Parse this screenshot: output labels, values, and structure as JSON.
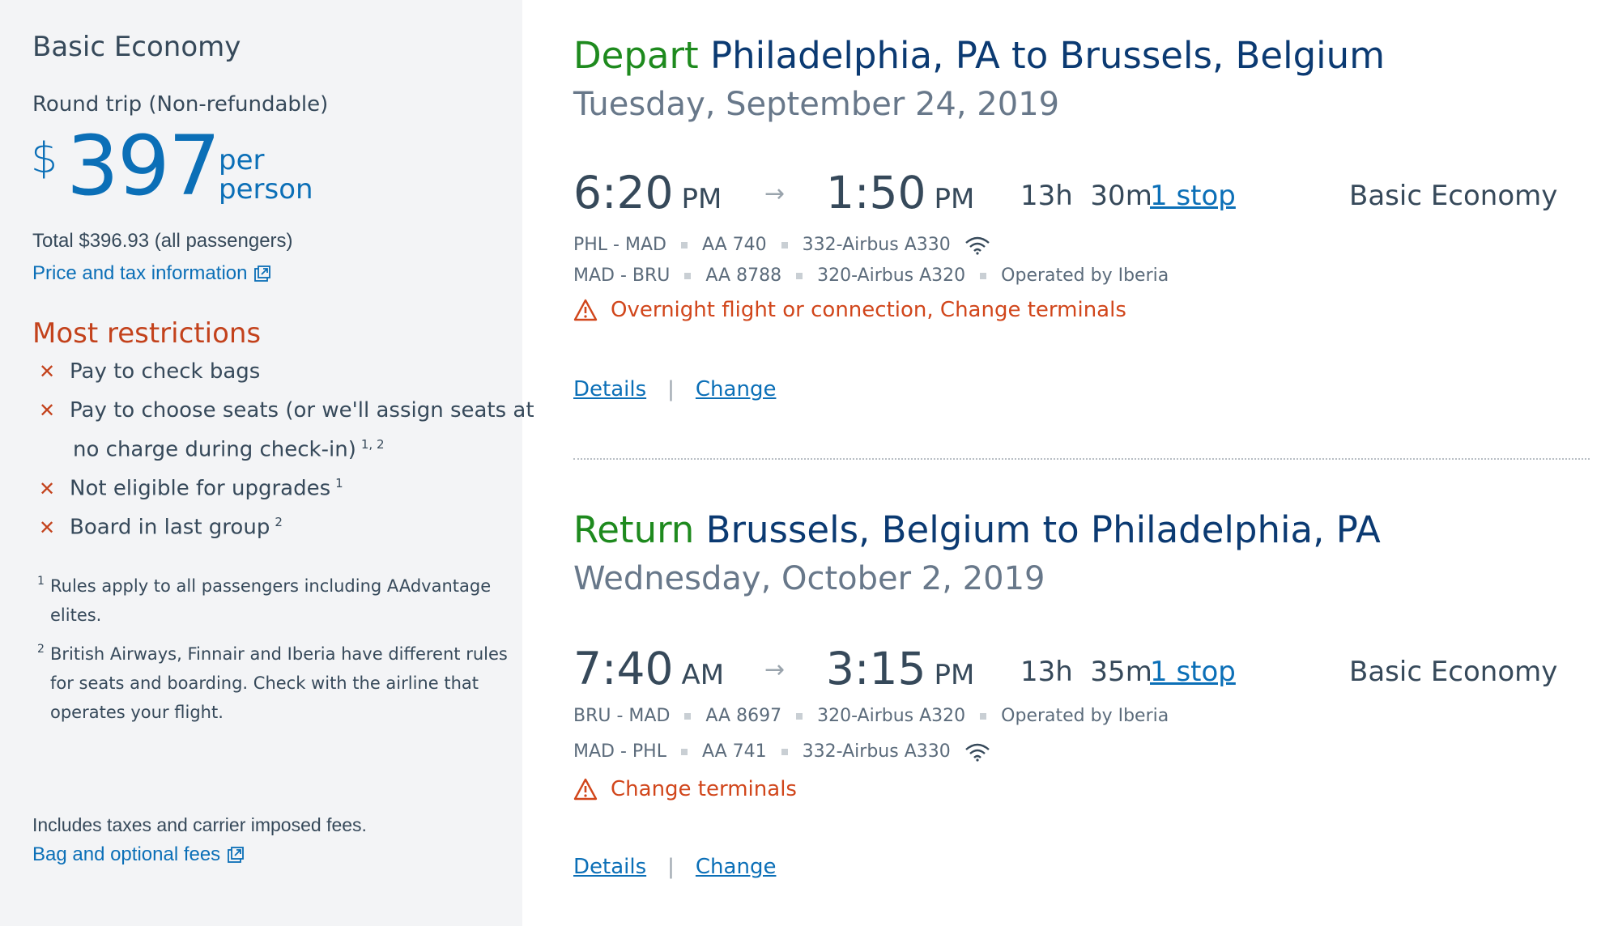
{
  "fare": {
    "title": "Basic Economy",
    "trip_type": "Round trip (Non-refundable)",
    "currency_symbol": "$",
    "price": "397",
    "per_line1": "per",
    "per_line2": "person",
    "total": "Total $396.93 (all passengers)",
    "price_tax_link": "Price and tax information"
  },
  "restrictions": {
    "title": "Most restrictions",
    "items": [
      {
        "text": "Pay to check bags",
        "sup": ""
      },
      {
        "text": "Pay to choose seats (or we'll assign seats at",
        "sup": ""
      },
      {
        "text": "Not eligible for upgrades",
        "sup": "1"
      },
      {
        "text": "Board in last group",
        "sup": "2"
      }
    ],
    "continuation": "no charge during check-in)",
    "continuation_sup": "1, 2",
    "footnotes": [
      {
        "num": "1",
        "text": "Rules apply to all passengers including AAdvantage elites."
      },
      {
        "num": "2",
        "text": "British Airways, Finnair and Iberia have different rules for seats and boarding. Check with the airline that operates your flight."
      }
    ]
  },
  "fees": {
    "includes": "Includes taxes and carrier imposed fees.",
    "bag_link": "Bag and optional fees"
  },
  "depart": {
    "label": "Depart",
    "route": "Philadelphia, PA to Brussels, Belgium",
    "date": "Tuesday, September 24, 2019",
    "dep_time": "6:20",
    "dep_ampm": "PM",
    "arr_time": "1:50",
    "arr_ampm": "PM",
    "duration": "13h  30m",
    "stops": "1 stop",
    "cabin": "Basic Economy",
    "segments": [
      {
        "route": "PHL - MAD",
        "flight": "AA 740",
        "aircraft": "332-Airbus A330",
        "operated": ""
      },
      {
        "route": "MAD - BRU",
        "flight": "AA 8788",
        "aircraft": "320-Airbus A320",
        "operated": "Operated by Iberia"
      }
    ],
    "warning": "Overnight flight or connection, Change terminals",
    "details": "Details",
    "change": "Change"
  },
  "return": {
    "label": "Return",
    "route": "Brussels, Belgium to Philadelphia, PA",
    "date": "Wednesday, October 2, 2019",
    "dep_time": "7:40",
    "dep_ampm": "AM",
    "arr_time": "3:15",
    "arr_ampm": "PM",
    "duration": "13h  35m",
    "stops": "1 stop",
    "cabin": "Basic Economy",
    "segments": [
      {
        "route": "BRU - MAD",
        "flight": "AA 8697",
        "aircraft": "320-Airbus A320",
        "operated": "Operated by Iberia"
      },
      {
        "route": "MAD - PHL",
        "flight": "AA 741",
        "aircraft": "332-Airbus A330",
        "operated": ""
      }
    ],
    "warning": "Change terminals",
    "details": "Details",
    "change": "Change"
  },
  "colors": {
    "accent_blue": "#0b6fb7",
    "route_navy": "#0b3a72",
    "direction_green": "#1e8a1e",
    "restriction_red": "#c3421c",
    "warning_orange": "#d1461b",
    "panel_gray": "#f3f4f6"
  },
  "icons": {
    "external": "external-link-icon",
    "wifi": "wifi-icon",
    "warning": "warning-triangle-icon",
    "restriction": "x-mark-icon",
    "arrow": "arrow-right-icon"
  }
}
